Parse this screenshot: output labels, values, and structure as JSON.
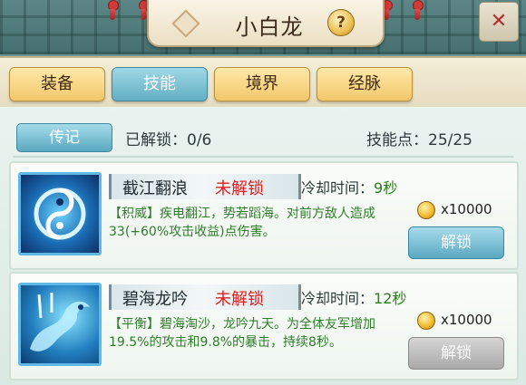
{
  "window": {
    "title": "小白龙",
    "help_label": "?",
    "close_label": "✕"
  },
  "tabs": [
    {
      "label": "装备",
      "active": false
    },
    {
      "label": "技能",
      "active": true
    },
    {
      "label": "境界",
      "active": false
    },
    {
      "label": "经脉",
      "active": false
    }
  ],
  "header": {
    "bio_button": "传记",
    "unlocked_label": "已解锁：0/6",
    "skill_points_label": "技能点：25/25"
  },
  "skills": [
    {
      "icon": "water-swirl-icon",
      "name": "截江翻浪",
      "status": "未解锁",
      "cooldown_label": "冷却时间：",
      "cooldown_value": "9秒",
      "desc_tag": "【积威】",
      "desc_text": "疾电翻江，势若蹈海。对前方敌人造成33(+60%攻击收益)点伤害。",
      "cost": "x10000",
      "unlock_label": "解锁",
      "unlock_enabled": true
    },
    {
      "icon": "blue-dragon-icon",
      "name": "碧海龙吟",
      "status": "未解锁",
      "cooldown_label": "冷却时间：",
      "cooldown_value": "12秒",
      "desc_tag": "【平衡】",
      "desc_text": "碧海淘沙，龙吟九天。为全体友军增加19.5%的攻击和9.8%的暴击，持续8秒。",
      "cost": "x10000",
      "unlock_label": "解锁",
      "unlock_enabled": false
    }
  ],
  "colors": {
    "locked_red": "#e02020",
    "desc_green": "#2e7d2a",
    "active_tab": "#62aec3"
  }
}
